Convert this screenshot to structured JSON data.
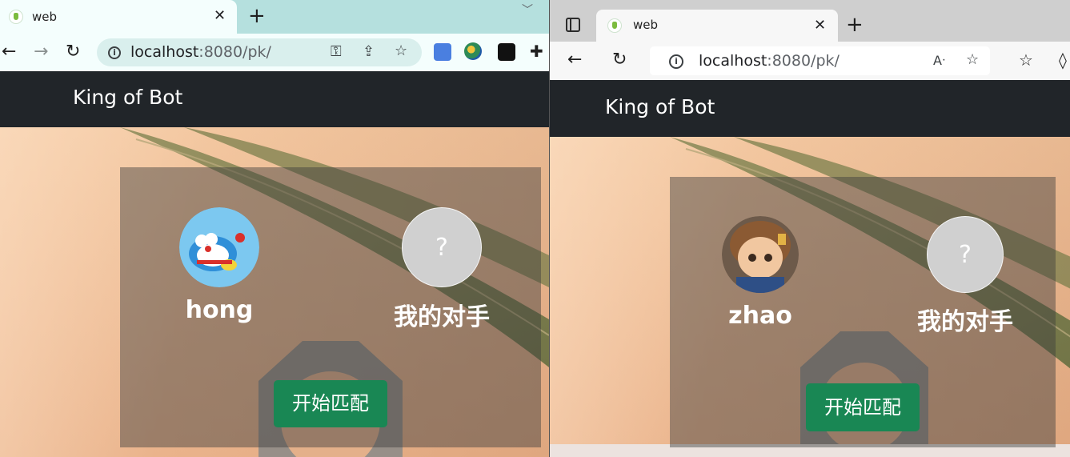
{
  "left_window": {
    "tab": {
      "title": "web"
    },
    "toolbar": {
      "url_host": "localhost",
      "url_rest": ":8080/pk/"
    },
    "page": {
      "brand": "King of Bot",
      "player": {
        "name": "hong",
        "avatar_icon": "doraemon-avatar-icon"
      },
      "opponent": {
        "label": "我的对手",
        "placeholder": "?"
      },
      "start_button": "开始匹配"
    }
  },
  "right_window": {
    "tab": {
      "title": "web"
    },
    "toolbar": {
      "url_host": "localhost",
      "url_rest": ":8080/pk/"
    },
    "page": {
      "brand": "King of Bot",
      "player": {
        "name": "zhao",
        "avatar_icon": "cartoon-boy-avatar-icon"
      },
      "opponent": {
        "label": "我的对手",
        "placeholder": "?"
      },
      "start_button": "开始匹配"
    }
  },
  "colors": {
    "navbar": "#212529",
    "start_button": "#198754",
    "chrome_tabstrip": "#b5e0de",
    "edge_tabstrip": "#cfcfcf"
  }
}
